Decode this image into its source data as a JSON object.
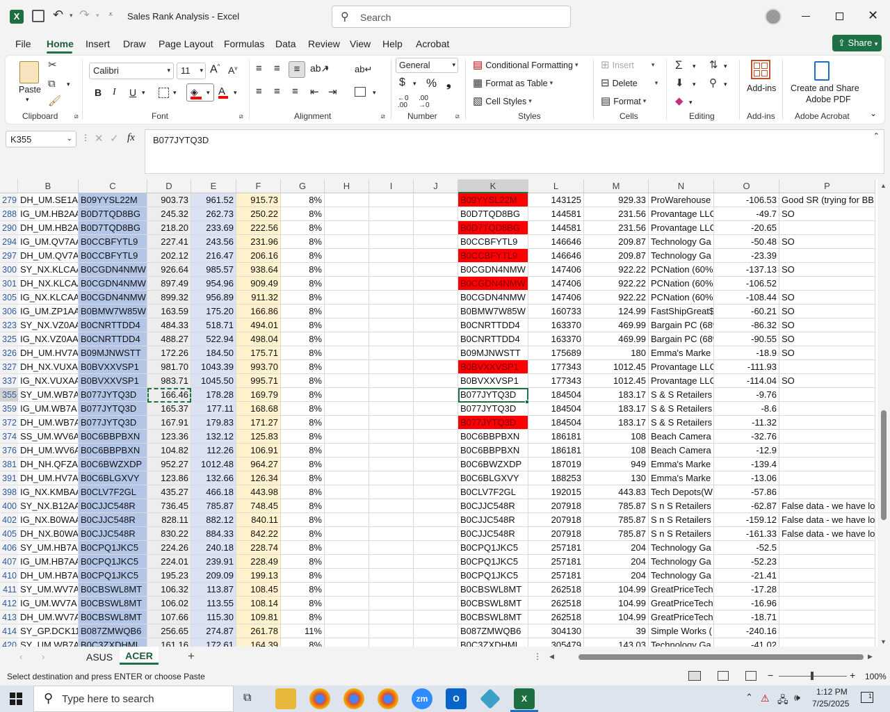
{
  "titlebar": {
    "title": "Sales Rank Analysis  -  Excel",
    "search_placeholder": "Search"
  },
  "tabs": [
    "File",
    "Home",
    "Insert",
    "Draw",
    "Page Layout",
    "Formulas",
    "Data",
    "Review",
    "View",
    "Help",
    "Acrobat"
  ],
  "share_label": "Share",
  "ribbon": {
    "paste": "Paste",
    "clipboard": "Clipboard",
    "font_name": "Calibri",
    "font_size": "11",
    "font": "Font",
    "alignment": "Alignment",
    "number_format": "General",
    "number": "Number",
    "cond_fmt": "Conditional Formatting",
    "fmt_table": "Format as Table",
    "cell_styles": "Cell Styles",
    "styles": "Styles",
    "insert": "Insert",
    "delete": "Delete",
    "format": "Format",
    "cells": "Cells",
    "editing": "Editing",
    "addins": "Add-ins",
    "addins_group": "Add-ins",
    "create_share": "Create and Share",
    "adobe_pdf": "Adobe PDF",
    "adobe_acrobat": "Adobe Acrobat"
  },
  "formula": {
    "namebox": "K355",
    "content": "B077JYTQ3D",
    "fx": "fx"
  },
  "columns": [
    "B",
    "C",
    "D",
    "E",
    "F",
    "G",
    "H",
    "I",
    "J",
    "K",
    "L",
    "M",
    "N",
    "O",
    "P"
  ],
  "rows": [
    {
      "r": "279",
      "b": "DH_UM.SE1AA",
      "c": "B09YYSL22M",
      "d": "903.73",
      "e": "961.52",
      "f": "915.73",
      "g": "8%",
      "k": "B09YYSL22M",
      "kred": true,
      "l": "143125",
      "m": "929.33",
      "n": "ProWarehouse",
      "o": "-106.53",
      "p": "Good SR (trying for BB"
    },
    {
      "r": "288",
      "b": "IG_UM.HB2AA",
      "c": "B0D7TQD8BG",
      "d": "245.32",
      "e": "262.73",
      "f": "250.22",
      "g": "8%",
      "k": "B0D7TQD8BG",
      "kred": false,
      "l": "144581",
      "m": "231.56",
      "n": "Provantage LLC",
      "o": "-49.7",
      "p": "SO"
    },
    {
      "r": "290",
      "b": "DH_UM.HB2AA",
      "c": "B0D7TQD8BG",
      "d": "218.20",
      "e": "233.69",
      "f": "222.56",
      "g": "8%",
      "k": "B0D7TQD8BG",
      "kred": true,
      "l": "144581",
      "m": "231.56",
      "n": "Provantage LLC",
      "o": "-20.65",
      "p": ""
    },
    {
      "r": "294",
      "b": "IG_UM.QV7AA",
      "c": "B0CCBFYTL9",
      "d": "227.41",
      "e": "243.56",
      "f": "231.96",
      "g": "8%",
      "k": "B0CCBFYTL9",
      "kred": false,
      "l": "146646",
      "m": "209.87",
      "n": "Technology Ga",
      "o": "-50.48",
      "p": "SO"
    },
    {
      "r": "297",
      "b": "DH_UM.QV7AA",
      "c": "B0CCBFYTL9",
      "d": "202.12",
      "e": "216.47",
      "f": "206.16",
      "g": "8%",
      "k": "B0CCBFYTL9",
      "kred": true,
      "l": "146646",
      "m": "209.87",
      "n": "Technology Ga",
      "o": "-23.39",
      "p": ""
    },
    {
      "r": "300",
      "b": "SY_NX.KLCAA",
      "c": "B0CGDN4NMW",
      "d": "926.64",
      "e": "985.57",
      "f": "938.64",
      "g": "8%",
      "k": "B0CGDN4NMW",
      "kred": false,
      "l": "147406",
      "m": "922.22",
      "n": "PCNation (60%",
      "o": "-137.13",
      "p": "SO"
    },
    {
      "r": "301",
      "b": "DH_NX.KLCAA",
      "c": "B0CGDN4NMW",
      "d": "897.49",
      "e": "954.96",
      "f": "909.49",
      "g": "8%",
      "k": "B0CGDN4NMW",
      "kred": true,
      "l": "147406",
      "m": "922.22",
      "n": "PCNation (60%",
      "o": "-106.52",
      "p": ""
    },
    {
      "r": "305",
      "b": "IG_NX.KLCAA",
      "c": "B0CGDN4NMW",
      "d": "899.32",
      "e": "956.89",
      "f": "911.32",
      "g": "8%",
      "k": "B0CGDN4NMW",
      "kred": false,
      "l": "147406",
      "m": "922.22",
      "n": "PCNation (60%",
      "o": "-108.44",
      "p": "SO"
    },
    {
      "r": "306",
      "b": "IG_UM.ZP1AA",
      "c": "B0BMW7W85W",
      "d": "163.59",
      "e": "175.20",
      "f": "166.86",
      "g": "8%",
      "k": "B0BMW7W85W",
      "kred": false,
      "l": "160733",
      "m": "124.99",
      "n": "FastShipGreat$",
      "o": "-60.21",
      "p": "SO"
    },
    {
      "r": "323",
      "b": "SY_NX.VZ0AA",
      "c": "B0CNRTTDD4",
      "d": "484.33",
      "e": "518.71",
      "f": "494.01",
      "g": "8%",
      "k": "B0CNRTTDD4",
      "kred": false,
      "l": "163370",
      "m": "469.99",
      "n": "Bargain PC (68%",
      "o": "-86.32",
      "p": "SO"
    },
    {
      "r": "325",
      "b": "IG_NX.VZ0AA",
      "c": "B0CNRTTDD4",
      "d": "488.27",
      "e": "522.94",
      "f": "498.04",
      "g": "8%",
      "k": "B0CNRTTDD4",
      "kred": false,
      "l": "163370",
      "m": "469.99",
      "n": "Bargain PC (68%",
      "o": "-90.55",
      "p": "SO"
    },
    {
      "r": "326",
      "b": "DH_UM.HV7A",
      "c": "B09MJNWSTT",
      "d": "172.26",
      "e": "184.50",
      "f": "175.71",
      "g": "8%",
      "k": "B09MJNWSTT",
      "kred": false,
      "l": "175689",
      "m": "180",
      "n": "Emma's Marke",
      "o": "-18.9",
      "p": "SO"
    },
    {
      "r": "327",
      "b": "DH_NX.VUXAA",
      "c": "B0BVXXVSP1",
      "d": "981.70",
      "e": "1043.39",
      "f": "993.70",
      "g": "8%",
      "k": "B0BVXXVSP1",
      "kred": true,
      "l": "177343",
      "m": "1012.45",
      "n": "Provantage LLC",
      "o": "-111.93",
      "p": ""
    },
    {
      "r": "337",
      "b": "IG_NX.VUXAA",
      "c": "B0BVXXVSP1",
      "d": "983.71",
      "e": "1045.50",
      "f": "995.71",
      "g": "8%",
      "k": "B0BVXXVSP1",
      "kred": false,
      "l": "177343",
      "m": "1012.45",
      "n": "Provantage LLC",
      "o": "-114.04",
      "p": "SO"
    },
    {
      "r": "355",
      "b": "SY_UM.WB7A",
      "c": "B077JYTQ3D",
      "d": "166.46",
      "e": "178.28",
      "f": "169.79",
      "g": "8%",
      "k": "B077JYTQ3D",
      "kred": false,
      "l": "184504",
      "m": "183.17",
      "n": "S & S Retailers",
      "o": "-9.76",
      "p": ""
    },
    {
      "r": "359",
      "b": "IG_UM.WB7A",
      "c": "B077JYTQ3D",
      "d": "165.37",
      "e": "177.11",
      "f": "168.68",
      "g": "8%",
      "k": "B077JYTQ3D",
      "kred": false,
      "l": "184504",
      "m": "183.17",
      "n": "S & S Retailers",
      "o": "-8.6",
      "p": ""
    },
    {
      "r": "372",
      "b": "DH_UM.WB7A",
      "c": "B077JYTQ3D",
      "d": "167.91",
      "e": "179.83",
      "f": "171.27",
      "g": "8%",
      "k": "B077JYTQ3D",
      "kred": true,
      "l": "184504",
      "m": "183.17",
      "n": "S & S Retailers",
      "o": "-11.32",
      "p": ""
    },
    {
      "r": "374",
      "b": "SS_UM.WV6A",
      "c": "B0C6BBPBXN",
      "d": "123.36",
      "e": "132.12",
      "f": "125.83",
      "g": "8%",
      "k": "B0C6BBPBXN",
      "kred": false,
      "l": "186181",
      "m": "108",
      "n": "Beach Camera",
      "o": "-32.76",
      "p": ""
    },
    {
      "r": "376",
      "b": "DH_UM.WV6A",
      "c": "B0C6BBPBXN",
      "d": "104.82",
      "e": "112.26",
      "f": "106.91",
      "g": "8%",
      "k": "B0C6BBPBXN",
      "kred": false,
      "l": "186181",
      "m": "108",
      "n": "Beach Camera",
      "o": "-12.9",
      "p": ""
    },
    {
      "r": "381",
      "b": "DH_NH.QFZAA",
      "c": "B0C6BWZXDP",
      "d": "952.27",
      "e": "1012.48",
      "f": "964.27",
      "g": "8%",
      "k": "B0C6BWZXDP",
      "kred": false,
      "l": "187019",
      "m": "949",
      "n": "Emma's Marke",
      "o": "-139.4",
      "p": ""
    },
    {
      "r": "391",
      "b": "DH_UM.HV7A",
      "c": "B0C6BLGXVY",
      "d": "123.86",
      "e": "132.66",
      "f": "126.34",
      "g": "8%",
      "k": "B0C6BLGXVY",
      "kred": false,
      "l": "188253",
      "m": "130",
      "n": "Emma's Marke",
      "o": "-13.06",
      "p": ""
    },
    {
      "r": "398",
      "b": "IG_NX.KMBAA",
      "c": "B0CLV7F2GL",
      "d": "435.27",
      "e": "466.18",
      "f": "443.98",
      "g": "8%",
      "k": "B0CLV7F2GL",
      "kred": false,
      "l": "192015",
      "m": "443.83",
      "n": "Tech Depots(W",
      "o": "-57.86",
      "p": ""
    },
    {
      "r": "400",
      "b": "SY_NX.B12AA",
      "c": "B0CJJC548R",
      "d": "736.45",
      "e": "785.87",
      "f": "748.45",
      "g": "8%",
      "k": "B0CJJC548R",
      "kred": false,
      "l": "207918",
      "m": "785.87",
      "n": "S n S Retailers",
      "o": "-62.87",
      "p": "False data - we have lo"
    },
    {
      "r": "402",
      "b": "IG_NX.B0WAA",
      "c": "B0CJJC548R",
      "d": "828.11",
      "e": "882.12",
      "f": "840.11",
      "g": "8%",
      "k": "B0CJJC548R",
      "kred": false,
      "l": "207918",
      "m": "785.87",
      "n": "S n S Retailers",
      "o": "-159.12",
      "p": "False data - we have lo"
    },
    {
      "r": "405",
      "b": "DH_NX.B0WAA",
      "c": "B0CJJC548R",
      "d": "830.22",
      "e": "884.33",
      "f": "842.22",
      "g": "8%",
      "k": "B0CJJC548R",
      "kred": false,
      "l": "207918",
      "m": "785.87",
      "n": "S n S Retailers",
      "o": "-161.33",
      "p": "False data - we have lo"
    },
    {
      "r": "406",
      "b": "SY_UM.HB7AA",
      "c": "B0CPQ1JKC5",
      "d": "224.26",
      "e": "240.18",
      "f": "228.74",
      "g": "8%",
      "k": "B0CPQ1JKC5",
      "kred": false,
      "l": "257181",
      "m": "204",
      "n": "Technology Ga",
      "o": "-52.5",
      "p": ""
    },
    {
      "r": "407",
      "b": "IG_UM.HB7AA",
      "c": "B0CPQ1JKC5",
      "d": "224.01",
      "e": "239.91",
      "f": "228.49",
      "g": "8%",
      "k": "B0CPQ1JKC5",
      "kred": false,
      "l": "257181",
      "m": "204",
      "n": "Technology Ga",
      "o": "-52.23",
      "p": ""
    },
    {
      "r": "410",
      "b": "DH_UM.HB7AA",
      "c": "B0CPQ1JKC5",
      "d": "195.23",
      "e": "209.09",
      "f": "199.13",
      "g": "8%",
      "k": "B0CPQ1JKC5",
      "kred": false,
      "l": "257181",
      "m": "204",
      "n": "Technology Ga",
      "o": "-21.41",
      "p": ""
    },
    {
      "r": "411",
      "b": "SY_UM.WV7A",
      "c": "B0CBSWL8MT",
      "d": "106.32",
      "e": "113.87",
      "f": "108.45",
      "g": "8%",
      "k": "B0CBSWL8MT",
      "kred": false,
      "l": "262518",
      "m": "104.99",
      "n": "GreatPriceTech",
      "o": "-17.28",
      "p": ""
    },
    {
      "r": "412",
      "b": "IG_UM.WV7A",
      "c": "B0CBSWL8MT",
      "d": "106.02",
      "e": "113.55",
      "f": "108.14",
      "g": "8%",
      "k": "B0CBSWL8MT",
      "kred": false,
      "l": "262518",
      "m": "104.99",
      "n": "GreatPriceTech",
      "o": "-16.96",
      "p": ""
    },
    {
      "r": "413",
      "b": "DH_UM.WV7A",
      "c": "B0CBSWL8MT",
      "d": "107.66",
      "e": "115.30",
      "f": "109.81",
      "g": "8%",
      "k": "B0CBSWL8MT",
      "kred": false,
      "l": "262518",
      "m": "104.99",
      "n": "GreatPriceTech",
      "o": "-18.71",
      "p": ""
    },
    {
      "r": "414",
      "b": "SY_GP.DCK11.",
      "c": "B087ZMWQB6",
      "d": "256.65",
      "e": "274.87",
      "f": "261.78",
      "g": "11%",
      "k": "B087ZMWQB6",
      "kred": false,
      "l": "304130",
      "m": "39",
      "n": "Simple Works (",
      "o": "-240.16",
      "p": ""
    },
    {
      "r": "420",
      "b": "SY_UM.WB7A",
      "c": "B0C3ZXDHML",
      "d": "161.16",
      "e": "172.61",
      "f": "164.39",
      "g": "8%",
      "k": "B0C3ZXDHML",
      "kred": false,
      "l": "305479",
      "m": "143.03",
      "n": "Technology Ga",
      "o": "-41.02",
      "p": ""
    }
  ],
  "sheets": [
    "ASUS",
    "ACER"
  ],
  "status": {
    "message": "Select destination and press ENTER or choose Paste",
    "zoom": "100%"
  },
  "taskbar": {
    "search_placeholder": "Type here to search",
    "time": "1:12 PM",
    "date": "7/25/2025"
  },
  "colors": {
    "excel_green": "#217346",
    "red_fill": "#ff0000",
    "col_c_fill": "#b4c6e7",
    "col_d_fill": "#ededed",
    "col_e_fill": "#dbe2f4",
    "col_f_fill": "#fff2cc"
  }
}
